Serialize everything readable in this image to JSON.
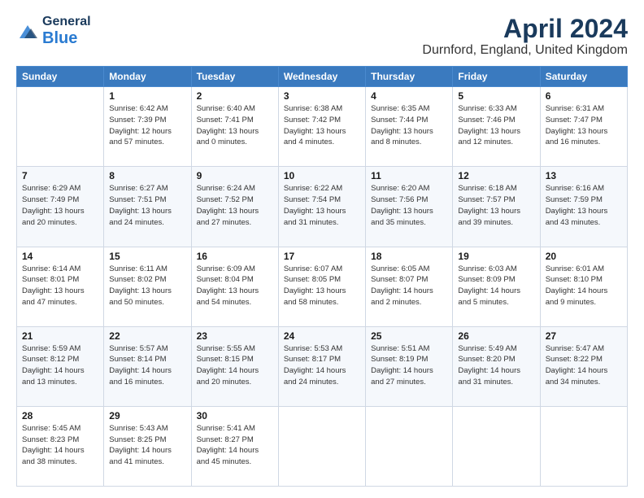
{
  "header": {
    "logo_general": "General",
    "logo_blue": "Blue",
    "month_title": "April 2024",
    "location": "Durnford, England, United Kingdom"
  },
  "days_of_week": [
    "Sunday",
    "Monday",
    "Tuesday",
    "Wednesday",
    "Thursday",
    "Friday",
    "Saturday"
  ],
  "weeks": [
    [
      {
        "day": "",
        "sunrise": "",
        "sunset": "",
        "daylight": ""
      },
      {
        "day": "1",
        "sunrise": "Sunrise: 6:42 AM",
        "sunset": "Sunset: 7:39 PM",
        "daylight": "Daylight: 12 hours and 57 minutes."
      },
      {
        "day": "2",
        "sunrise": "Sunrise: 6:40 AM",
        "sunset": "Sunset: 7:41 PM",
        "daylight": "Daylight: 13 hours and 0 minutes."
      },
      {
        "day": "3",
        "sunrise": "Sunrise: 6:38 AM",
        "sunset": "Sunset: 7:42 PM",
        "daylight": "Daylight: 13 hours and 4 minutes."
      },
      {
        "day": "4",
        "sunrise": "Sunrise: 6:35 AM",
        "sunset": "Sunset: 7:44 PM",
        "daylight": "Daylight: 13 hours and 8 minutes."
      },
      {
        "day": "5",
        "sunrise": "Sunrise: 6:33 AM",
        "sunset": "Sunset: 7:46 PM",
        "daylight": "Daylight: 13 hours and 12 minutes."
      },
      {
        "day": "6",
        "sunrise": "Sunrise: 6:31 AM",
        "sunset": "Sunset: 7:47 PM",
        "daylight": "Daylight: 13 hours and 16 minutes."
      }
    ],
    [
      {
        "day": "7",
        "sunrise": "Sunrise: 6:29 AM",
        "sunset": "Sunset: 7:49 PM",
        "daylight": "Daylight: 13 hours and 20 minutes."
      },
      {
        "day": "8",
        "sunrise": "Sunrise: 6:27 AM",
        "sunset": "Sunset: 7:51 PM",
        "daylight": "Daylight: 13 hours and 24 minutes."
      },
      {
        "day": "9",
        "sunrise": "Sunrise: 6:24 AM",
        "sunset": "Sunset: 7:52 PM",
        "daylight": "Daylight: 13 hours and 27 minutes."
      },
      {
        "day": "10",
        "sunrise": "Sunrise: 6:22 AM",
        "sunset": "Sunset: 7:54 PM",
        "daylight": "Daylight: 13 hours and 31 minutes."
      },
      {
        "day": "11",
        "sunrise": "Sunrise: 6:20 AM",
        "sunset": "Sunset: 7:56 PM",
        "daylight": "Daylight: 13 hours and 35 minutes."
      },
      {
        "day": "12",
        "sunrise": "Sunrise: 6:18 AM",
        "sunset": "Sunset: 7:57 PM",
        "daylight": "Daylight: 13 hours and 39 minutes."
      },
      {
        "day": "13",
        "sunrise": "Sunrise: 6:16 AM",
        "sunset": "Sunset: 7:59 PM",
        "daylight": "Daylight: 13 hours and 43 minutes."
      }
    ],
    [
      {
        "day": "14",
        "sunrise": "Sunrise: 6:14 AM",
        "sunset": "Sunset: 8:01 PM",
        "daylight": "Daylight: 13 hours and 47 minutes."
      },
      {
        "day": "15",
        "sunrise": "Sunrise: 6:11 AM",
        "sunset": "Sunset: 8:02 PM",
        "daylight": "Daylight: 13 hours and 50 minutes."
      },
      {
        "day": "16",
        "sunrise": "Sunrise: 6:09 AM",
        "sunset": "Sunset: 8:04 PM",
        "daylight": "Daylight: 13 hours and 54 minutes."
      },
      {
        "day": "17",
        "sunrise": "Sunrise: 6:07 AM",
        "sunset": "Sunset: 8:05 PM",
        "daylight": "Daylight: 13 hours and 58 minutes."
      },
      {
        "day": "18",
        "sunrise": "Sunrise: 6:05 AM",
        "sunset": "Sunset: 8:07 PM",
        "daylight": "Daylight: 14 hours and 2 minutes."
      },
      {
        "day": "19",
        "sunrise": "Sunrise: 6:03 AM",
        "sunset": "Sunset: 8:09 PM",
        "daylight": "Daylight: 14 hours and 5 minutes."
      },
      {
        "day": "20",
        "sunrise": "Sunrise: 6:01 AM",
        "sunset": "Sunset: 8:10 PM",
        "daylight": "Daylight: 14 hours and 9 minutes."
      }
    ],
    [
      {
        "day": "21",
        "sunrise": "Sunrise: 5:59 AM",
        "sunset": "Sunset: 8:12 PM",
        "daylight": "Daylight: 14 hours and 13 minutes."
      },
      {
        "day": "22",
        "sunrise": "Sunrise: 5:57 AM",
        "sunset": "Sunset: 8:14 PM",
        "daylight": "Daylight: 14 hours and 16 minutes."
      },
      {
        "day": "23",
        "sunrise": "Sunrise: 5:55 AM",
        "sunset": "Sunset: 8:15 PM",
        "daylight": "Daylight: 14 hours and 20 minutes."
      },
      {
        "day": "24",
        "sunrise": "Sunrise: 5:53 AM",
        "sunset": "Sunset: 8:17 PM",
        "daylight": "Daylight: 14 hours and 24 minutes."
      },
      {
        "day": "25",
        "sunrise": "Sunrise: 5:51 AM",
        "sunset": "Sunset: 8:19 PM",
        "daylight": "Daylight: 14 hours and 27 minutes."
      },
      {
        "day": "26",
        "sunrise": "Sunrise: 5:49 AM",
        "sunset": "Sunset: 8:20 PM",
        "daylight": "Daylight: 14 hours and 31 minutes."
      },
      {
        "day": "27",
        "sunrise": "Sunrise: 5:47 AM",
        "sunset": "Sunset: 8:22 PM",
        "daylight": "Daylight: 14 hours and 34 minutes."
      }
    ],
    [
      {
        "day": "28",
        "sunrise": "Sunrise: 5:45 AM",
        "sunset": "Sunset: 8:23 PM",
        "daylight": "Daylight: 14 hours and 38 minutes."
      },
      {
        "day": "29",
        "sunrise": "Sunrise: 5:43 AM",
        "sunset": "Sunset: 8:25 PM",
        "daylight": "Daylight: 14 hours and 41 minutes."
      },
      {
        "day": "30",
        "sunrise": "Sunrise: 5:41 AM",
        "sunset": "Sunset: 8:27 PM",
        "daylight": "Daylight: 14 hours and 45 minutes."
      },
      {
        "day": "",
        "sunrise": "",
        "sunset": "",
        "daylight": ""
      },
      {
        "day": "",
        "sunrise": "",
        "sunset": "",
        "daylight": ""
      },
      {
        "day": "",
        "sunrise": "",
        "sunset": "",
        "daylight": ""
      },
      {
        "day": "",
        "sunrise": "",
        "sunset": "",
        "daylight": ""
      }
    ]
  ]
}
